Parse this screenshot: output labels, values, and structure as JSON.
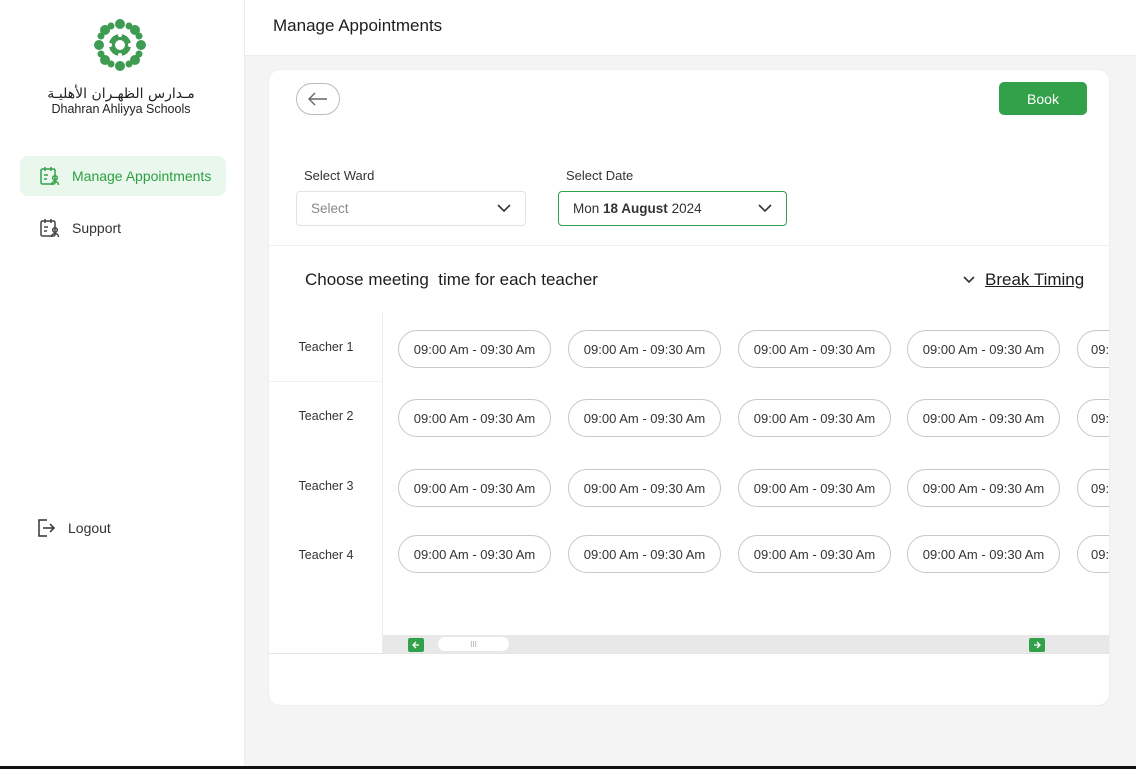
{
  "brand": {
    "name_ar": "مـدارس الظهـران الأهليـة",
    "name_en": "Dhahran Ahliyya Schools",
    "color": "#33a14a"
  },
  "sidebar": {
    "items": [
      {
        "label": "Manage Appointments",
        "icon": "calendar-user-icon",
        "active": true
      },
      {
        "label": "Support",
        "icon": "calendar-user-icon",
        "active": false
      }
    ],
    "logout_label": "Logout"
  },
  "header": {
    "title": "Manage Appointments"
  },
  "toolbar": {
    "book_label": "Book"
  },
  "filters": {
    "ward": {
      "label": "Select Ward",
      "value": "Select"
    },
    "date": {
      "label": "Select Date",
      "day": "Mon",
      "date": "18 August",
      "year": "2024"
    }
  },
  "schedule": {
    "title": "Choose meeting  time for each teacher",
    "break_label": "Break Timing",
    "teachers": [
      "Teacher 1",
      "Teacher 2",
      "Teacher 3",
      "Teacher 4"
    ],
    "slot_label": "09:00 Am - 09:30 Am",
    "scroll_thumb": "III"
  }
}
